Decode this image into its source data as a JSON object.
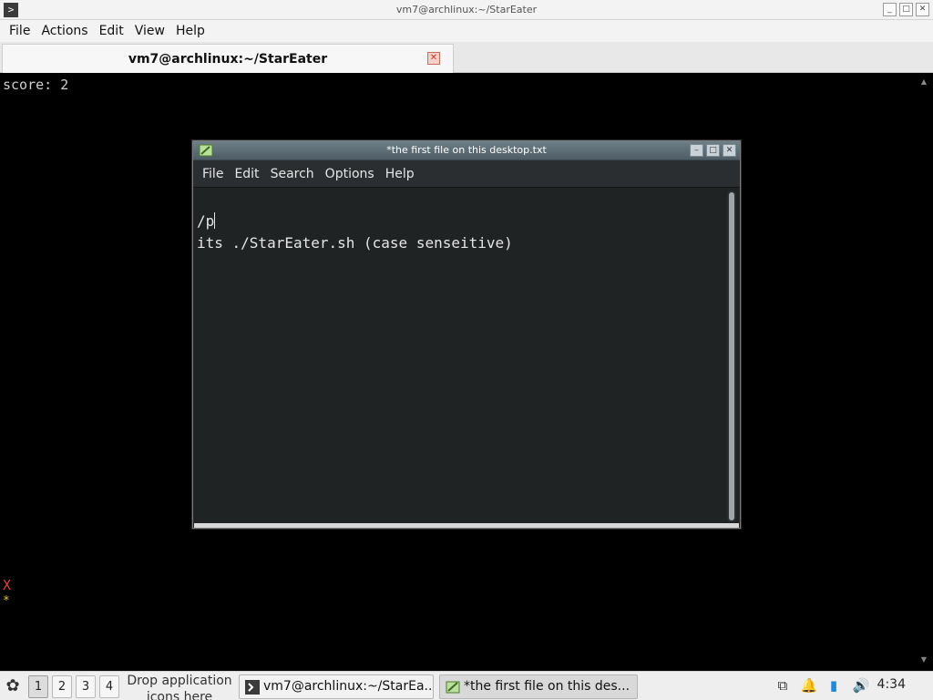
{
  "terminal": {
    "window_title": "vm7@archlinux:~/StarEater",
    "menu": [
      "File",
      "Actions",
      "Edit",
      "View",
      "Help"
    ],
    "tab_label": "vm7@archlinux:~/StarEater",
    "score_line": "score: 2",
    "sprite_x": "X",
    "sprite_star": "*",
    "colors": {
      "x": "#d9413a",
      "star": "#e5c144"
    }
  },
  "editor": {
    "window_title": "*the first file on this desktop.txt",
    "menu": [
      "File",
      "Edit",
      "Search",
      "Options",
      "Help"
    ],
    "lines": [
      "/p",
      "its ./StarEater.sh (case senseitive)"
    ]
  },
  "taskbar": {
    "workspaces": [
      "1",
      "2",
      "3",
      "4"
    ],
    "active_workspace": "1",
    "drop_hint": "Drop application icons here",
    "tasks": [
      {
        "label": "vm7@archlinux:~/StarEa...",
        "icon": "terminal-icon"
      },
      {
        "label": "*the first file on this des...",
        "icon": "text-editor-icon"
      }
    ],
    "clock": "4:34"
  }
}
